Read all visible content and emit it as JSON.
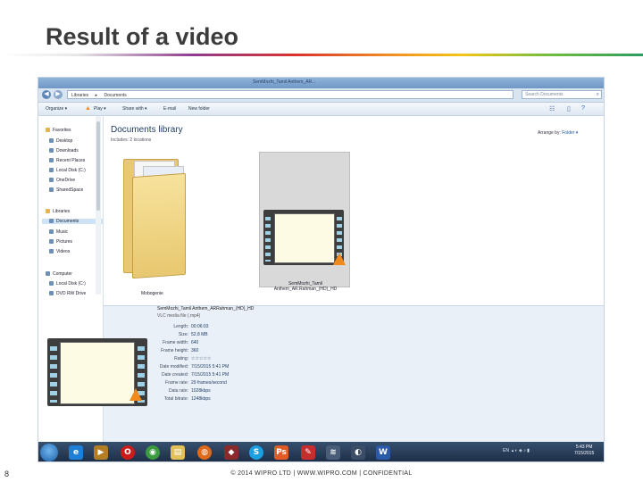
{
  "slide": {
    "title": "Result of a video",
    "page_number": "8",
    "footer": "© 2014 WIPRO LTD | WWW.WIPRO.COM | CONFIDENTIAL"
  },
  "explorer": {
    "window_title": "SemMozhi_Tamil Anthem_AR...",
    "breadcrumb": [
      "Libraries",
      "Documents"
    ],
    "search_placeholder": "Search Documents",
    "toolbar": {
      "organize": "Organize ▾",
      "play": "Play ▾",
      "share": "Share with ▾",
      "email": "E-mail",
      "new_folder": "New folder"
    },
    "nav": {
      "favorites": "Favorites",
      "favorites_items": [
        "Desktop",
        "Downloads",
        "Recent Places",
        "Local Disk (C:)",
        "OneDrive",
        "SharedSpace"
      ],
      "libraries": "Libraries",
      "libraries_items": [
        "Documents",
        "Music",
        "Pictures",
        "Videos"
      ],
      "computer": "Computer",
      "computer_items": [
        "Local Disk (C:)",
        "DVD RW Drive"
      ]
    },
    "library": {
      "title": "Documents library",
      "subtitle": "Includes: 2 locations",
      "arrange_by_label": "Arrange by:",
      "arrange_by_value": "Folder ▾"
    },
    "items": [
      {
        "name": "Mobogenie",
        "type": "folder"
      },
      {
        "name": "SemMozhi_Tamil Anthem_AR.Rahman_(HD)_HD",
        "type": "video"
      }
    ],
    "details": {
      "filename": "SemMozhi_Tamil Anthem_ARRahman_(HD)_HD",
      "filetype": "VLC media file (.mp4)",
      "fields": [
        {
          "key": "Length:",
          "value": "00:06:03"
        },
        {
          "key": "Size:",
          "value": "52.8 MB"
        },
        {
          "key": "Frame width:",
          "value": "640"
        },
        {
          "key": "Frame height:",
          "value": "360"
        },
        {
          "key": "Rating:",
          "value": "☆☆☆☆☆"
        },
        {
          "key": "Date modified:",
          "value": "7/15/2015 5:41 PM"
        },
        {
          "key": "Date created:",
          "value": "7/15/2015 5:41 PM"
        },
        {
          "key": "Frame rate:",
          "value": "29 frames/second"
        },
        {
          "key": "Data rate:",
          "value": "1028kbps"
        },
        {
          "key": "Total bitrate:",
          "value": "1248kbps"
        }
      ]
    },
    "taskbar": {
      "icons": [
        "ie-icon",
        "media-icon",
        "opera-icon",
        "chrome-icon",
        "files-icon",
        "firefox-icon",
        "app-icon",
        "skype-icon",
        "paint-icon",
        "pdf-icon",
        "audio-icon",
        "vlc-icon",
        "word-icon"
      ],
      "lang": "EN",
      "time": "5:43 PM",
      "date": "7/15/2015"
    },
    "colors": {
      "accent": "#1f5ea8",
      "taskbar": "#1c2c44",
      "folder": "#e8c874",
      "vlc_cone": "#f08a1c"
    }
  }
}
